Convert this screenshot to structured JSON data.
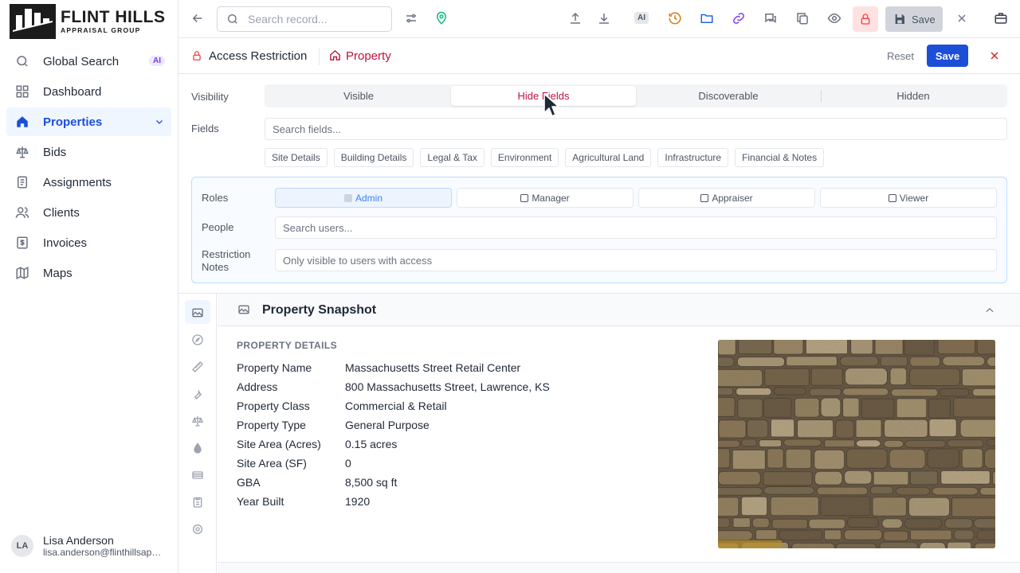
{
  "brand": {
    "name": "FLINT HILLS",
    "subtitle": "APPRAISAL GROUP"
  },
  "sidebar": {
    "items": [
      {
        "label": "Global Search",
        "icon": "search-icon",
        "badge": "AI"
      },
      {
        "label": "Dashboard",
        "icon": "grid-icon"
      },
      {
        "label": "Properties",
        "icon": "home-icon",
        "active": true
      },
      {
        "label": "Bids",
        "icon": "scale-icon"
      },
      {
        "label": "Assignments",
        "icon": "clipboard-icon"
      },
      {
        "label": "Clients",
        "icon": "users-icon"
      },
      {
        "label": "Invoices",
        "icon": "invoice-icon"
      },
      {
        "label": "Maps",
        "icon": "map-icon"
      }
    ]
  },
  "user": {
    "initials": "LA",
    "name": "Lisa Anderson",
    "email": "lisa.anderson@flinthillsappraisal.com"
  },
  "toolbar": {
    "search_placeholder": "Search record...",
    "ai_label": "AI",
    "save_label": "Save"
  },
  "access": {
    "title": "Access Restriction",
    "record": "Property",
    "reset_label": "Reset",
    "save_label": "Save",
    "visibility_label": "Visibility",
    "visibility_options": [
      "Visible",
      "Hide Fields",
      "Discoverable",
      "Hidden"
    ],
    "visibility_selected": "Hide Fields",
    "fields_label": "Fields",
    "fields_placeholder": "Search fields...",
    "field_groups": [
      "Site Details",
      "Building Details",
      "Legal & Tax",
      "Environment",
      "Agricultural Land",
      "Infrastructure",
      "Financial & Notes"
    ],
    "roles_label": "Roles",
    "roles": [
      {
        "label": "Admin",
        "checked": true
      },
      {
        "label": "Manager",
        "checked": false
      },
      {
        "label": "Appraiser",
        "checked": false
      },
      {
        "label": "Viewer",
        "checked": false
      }
    ],
    "people_label": "People",
    "people_placeholder": "Search users...",
    "notes_label_1": "Restriction",
    "notes_label_2": "Notes",
    "notes_placeholder": "Only visible to users with access"
  },
  "section": {
    "title": "Property Snapshot",
    "subtitle": "PROPERTY DETAILS",
    "fields": [
      {
        "key": "Property Name",
        "value": "Massachusetts Street Retail Center"
      },
      {
        "key": "Address",
        "value": "800 Massachusetts Street, Lawrence, KS"
      },
      {
        "key": "Property Class",
        "value": "Commercial & Retail"
      },
      {
        "key": "Property Type",
        "value": "General Purpose"
      },
      {
        "key": "Site Area (Acres)",
        "value": "0.15 acres"
      },
      {
        "key": "Site Area (SF)",
        "value": "0"
      },
      {
        "key": "GBA",
        "value": "8,500 sq ft"
      },
      {
        "key": "Year Built",
        "value": "1920"
      }
    ]
  },
  "colors": {
    "accent": "#1d4ed8",
    "danger": "#be123c",
    "ai": "#7c3aed"
  }
}
